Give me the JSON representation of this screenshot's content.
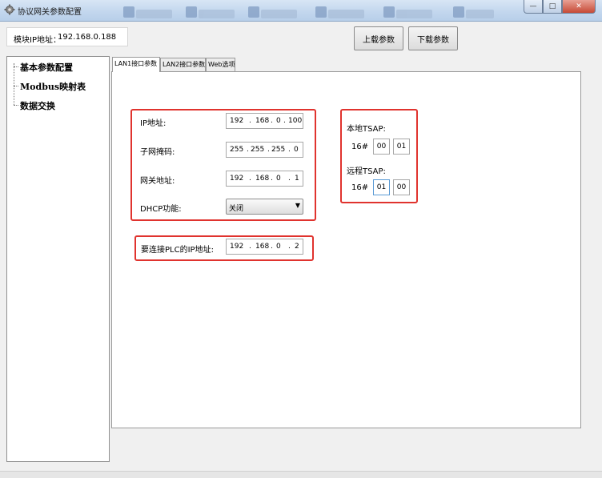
{
  "window": {
    "title": "协议网关参数配置",
    "minimize": "—",
    "maximize": "□",
    "close": "✕"
  },
  "module_ip": {
    "label": "模块IP地址：",
    "value": "192.168.0.188"
  },
  "toolbar": {
    "upload_label": "上载参数",
    "download_label": "下载参数"
  },
  "tree": {
    "items": [
      {
        "label": "基本参数配置"
      },
      {
        "label": "Modbus映射表"
      },
      {
        "label": "数据交换"
      }
    ]
  },
  "tabs": [
    {
      "label": "LAN1接口参数"
    },
    {
      "label": "LAN2接口参数"
    },
    {
      "label": "Web选项"
    }
  ],
  "lan1": {
    "ip": {
      "label": "IP地址:",
      "octets": [
        "192",
        "168",
        "0",
        "100"
      ]
    },
    "mask": {
      "label": "子网掩码:",
      "octets": [
        "255",
        "255",
        "255",
        "0"
      ]
    },
    "gateway": {
      "label": "网关地址:",
      "octets": [
        "192",
        "168",
        "0",
        "1"
      ]
    },
    "dhcp": {
      "label": "DHCP功能:",
      "value": "关闭"
    },
    "plc": {
      "label": "要连接PLC的IP地址:",
      "octets": [
        "192",
        "168",
        "0",
        "2"
      ]
    }
  },
  "tsap": {
    "local": {
      "label": "本地TSAP:",
      "prefix": "16#",
      "b1": "00",
      "b2": "01"
    },
    "remote": {
      "label": "远程TSAP:",
      "prefix": "16#",
      "b1": "01",
      "b2": "00"
    }
  },
  "colors": {
    "highlight": "#e0332e",
    "titlebar": "#c3d7ee"
  },
  "icons": {
    "app": "gear-icon",
    "dropdown": "chevron-down-icon"
  }
}
